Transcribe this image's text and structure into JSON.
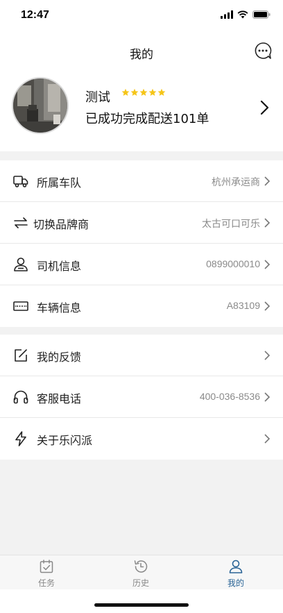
{
  "status": {
    "time": "12:47"
  },
  "header": {
    "title": "我的"
  },
  "profile": {
    "name": "测试",
    "rating": 5,
    "summary": "已成功完成配送101单"
  },
  "menu_group_1": [
    {
      "label": "所属车队",
      "value": "杭州承运商",
      "icon": "truck-icon"
    },
    {
      "label": "切换品牌商",
      "value": "太古可口可乐",
      "icon": "swap-arrows-icon"
    },
    {
      "label": "司机信息",
      "value": "0899000010",
      "icon": "driver-icon"
    },
    {
      "label": "车辆信息",
      "value": "A83109",
      "icon": "license-plate-icon"
    }
  ],
  "menu_group_2": [
    {
      "label": "我的反馈",
      "value": "",
      "icon": "edit-icon"
    },
    {
      "label": "客服电话",
      "value": "400-036-8536",
      "icon": "headphones-icon"
    },
    {
      "label": "关于乐闪派",
      "value": "",
      "icon": "lightning-icon"
    }
  ],
  "tabbar": {
    "tabs": [
      {
        "label": "任务",
        "icon": "calendar-check-icon"
      },
      {
        "label": "历史",
        "icon": "history-clock-icon"
      },
      {
        "label": "我的",
        "icon": "person-icon",
        "active": true
      }
    ]
  },
  "colors": {
    "accent": "#2a6496",
    "star": "#f5c518",
    "background": "#f2f2f2"
  }
}
